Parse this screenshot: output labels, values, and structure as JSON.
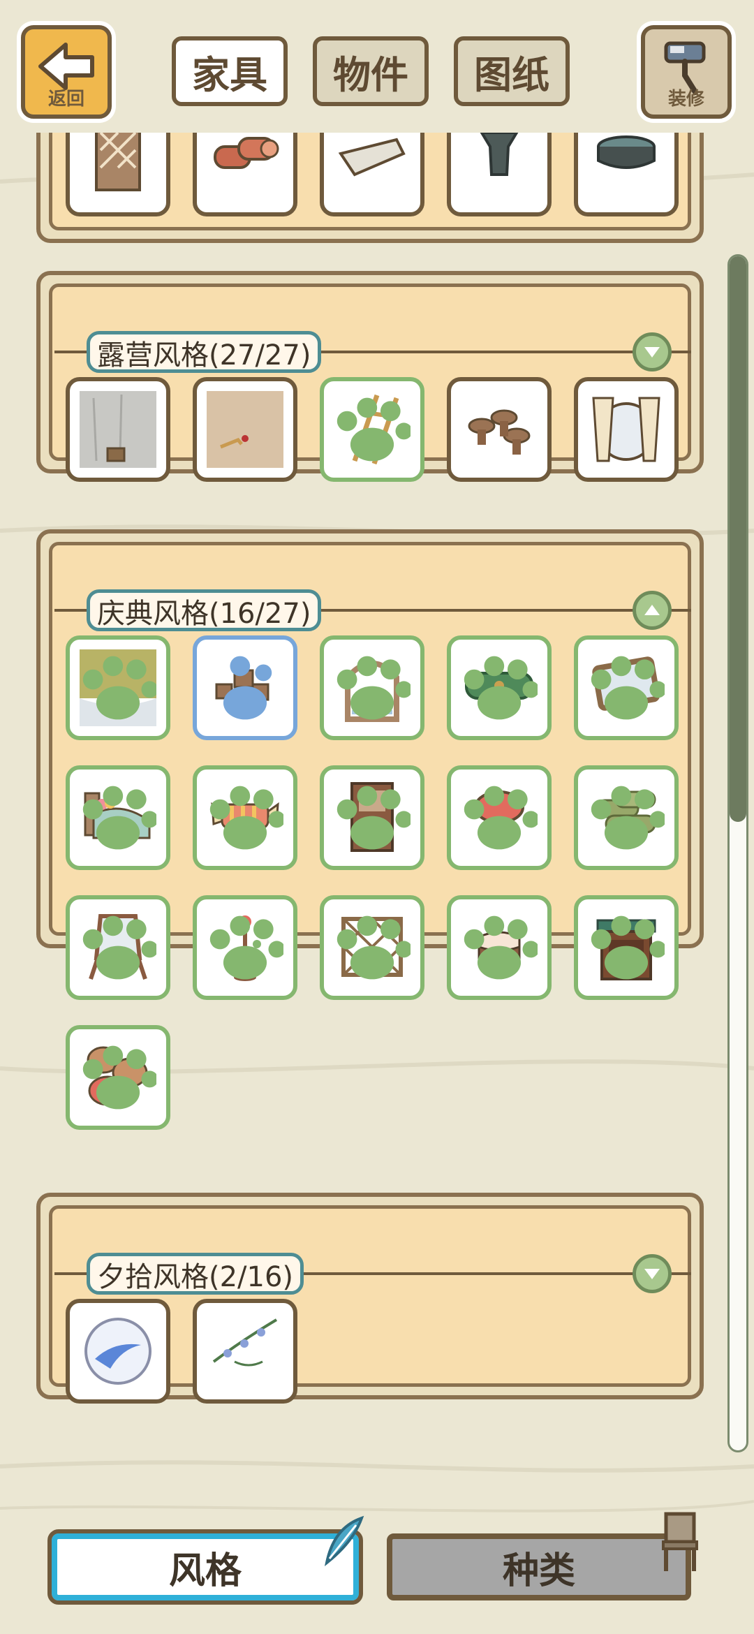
{
  "header": {
    "back_label": "返回",
    "renovate_label": "装修",
    "tabs": [
      {
        "label": "家具",
        "active": true
      },
      {
        "label": "物件",
        "active": false
      },
      {
        "label": "图纸",
        "active": false
      }
    ]
  },
  "sections": [
    {
      "title": "",
      "toggle": "none",
      "items": [
        {
          "icon": "wooden-door-icon",
          "state": "plain"
        },
        {
          "icon": "rolled-carpets-icon",
          "state": "plain"
        },
        {
          "icon": "rolled-paper-icon",
          "state": "plain"
        },
        {
          "icon": "stone-pedestal-icon",
          "state": "plain"
        },
        {
          "icon": "round-basin-icon",
          "state": "plain"
        }
      ]
    },
    {
      "title": "露营风格(27/27)",
      "toggle": "expand",
      "items": [
        {
          "icon": "grey-wall-backdrop-icon",
          "state": "plain"
        },
        {
          "icon": "sandy-floor-icon",
          "state": "plain"
        },
        {
          "icon": "wooden-ladder-icon",
          "state": "owned"
        },
        {
          "icon": "mushroom-stools-icon",
          "state": "plain"
        },
        {
          "icon": "curtained-window-icon",
          "state": "plain"
        }
      ]
    },
    {
      "title": "庆典风格(16/27)",
      "toggle": "collapse",
      "items": [
        {
          "icon": "olive-wallpaper-icon",
          "state": "owned"
        },
        {
          "icon": "stacked-pots-icon",
          "state": "selected"
        },
        {
          "icon": "arched-window-icon",
          "state": "owned"
        },
        {
          "icon": "green-sleeping-bag-icon",
          "state": "owned"
        },
        {
          "icon": "tablet-frame-icon",
          "state": "owned"
        },
        {
          "icon": "bed-icon",
          "state": "owned"
        },
        {
          "icon": "candy-pillow-icon",
          "state": "owned"
        },
        {
          "icon": "fireplace-cabinet-icon",
          "state": "owned"
        },
        {
          "icon": "red-mushroom-stool-icon",
          "state": "owned"
        },
        {
          "icon": "green-rolls-icon",
          "state": "owned"
        },
        {
          "icon": "easel-mirror-icon",
          "state": "owned"
        },
        {
          "icon": "coat-stand-icon",
          "state": "owned"
        },
        {
          "icon": "lattice-screen-icon",
          "state": "owned"
        },
        {
          "icon": "cake-icon",
          "state": "owned"
        },
        {
          "icon": "wooden-cabinet-icon",
          "state": "owned"
        },
        {
          "icon": "sack-pile-icon",
          "state": "owned"
        }
      ]
    },
    {
      "title": "夕拾风格(2/16)",
      "toggle": "expand",
      "items": [
        {
          "icon": "marble-orb-icon",
          "state": "plain"
        },
        {
          "icon": "flower-vine-icon",
          "state": "plain"
        }
      ]
    }
  ],
  "bottom_tabs": [
    {
      "label": "风格",
      "active": true,
      "icon": "feather-icon"
    },
    {
      "label": "种类",
      "active": false,
      "icon": "chair-icon"
    }
  ],
  "colors": {
    "background": "#ebe7d3",
    "panel": "#f8deae",
    "owned_border": "#85b76f",
    "selected_border": "#77a6da",
    "accent_tab": "#2fb0d8"
  }
}
